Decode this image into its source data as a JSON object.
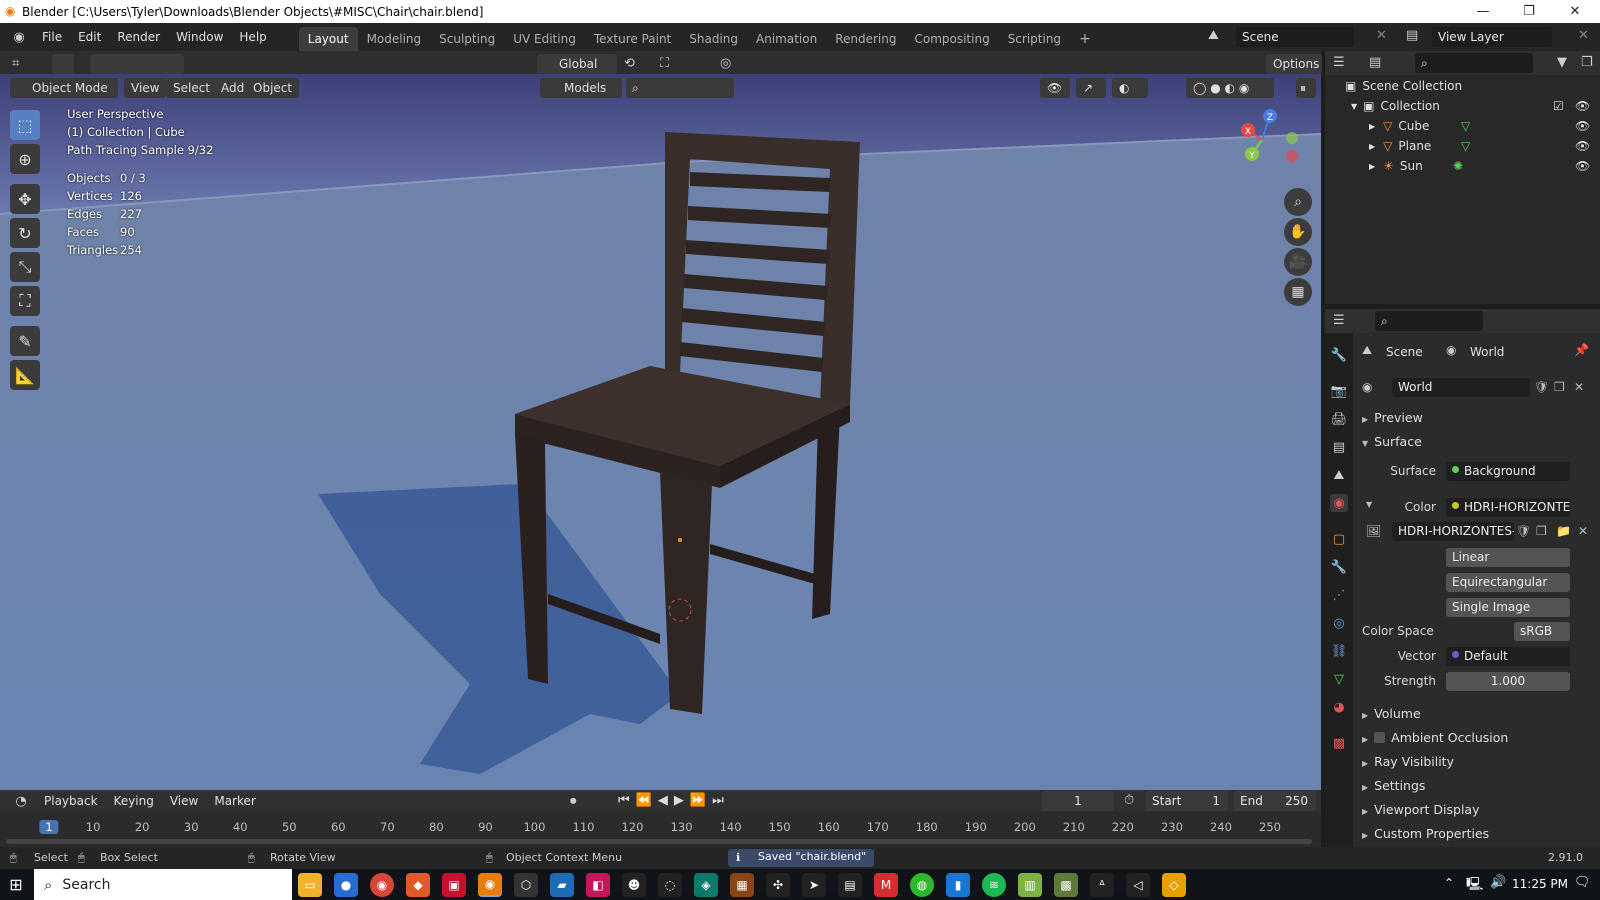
{
  "window": {
    "title": "Blender [C:\\Users\\Tyler\\Downloads\\Blender Objects\\#MISC\\Chair\\chair.blend]"
  },
  "menu": {
    "items": [
      "File",
      "Edit",
      "Render",
      "Window",
      "Help"
    ]
  },
  "workspaces": [
    "Layout",
    "Modeling",
    "Sculpting",
    "UV Editing",
    "Texture Paint",
    "Shading",
    "Animation",
    "Rendering",
    "Compositing",
    "Scripting"
  ],
  "active_workspace": "Layout",
  "scene_field": "Scene",
  "view_layer_field": "View Layer",
  "header": {
    "transform_orientation": "Global",
    "options_label": "Options"
  },
  "viewport_header": {
    "mode": "Object Mode",
    "view": "View",
    "select": "Select",
    "add": "Add",
    "object": "Object",
    "collection_filter": "Models"
  },
  "overlay": {
    "perspective": "User Perspective",
    "collection": "(1) Collection | Cube",
    "sample": "Path Tracing Sample 9/32"
  },
  "stats": [
    {
      "label": "Objects",
      "value": "0 / 3"
    },
    {
      "label": "Vertices",
      "value": "126"
    },
    {
      "label": "Edges",
      "value": "227"
    },
    {
      "label": "Faces",
      "value": "90"
    },
    {
      "label": "Triangles",
      "value": "254"
    }
  ],
  "gizmo": {
    "x": "X",
    "y": "Y",
    "z": "Z"
  },
  "outliner": {
    "root": "Scene Collection",
    "collection": "Collection",
    "items": [
      {
        "name": "Cube",
        "icon": "mesh-icon"
      },
      {
        "name": "Plane",
        "icon": "mesh-icon"
      },
      {
        "name": "Sun",
        "icon": "light-icon"
      }
    ]
  },
  "properties": {
    "breadcrumb_scene": "Scene",
    "breadcrumb_world": "World",
    "world_name": "World",
    "sections": {
      "preview": "Preview",
      "surface": "Surface",
      "volume": "Volume",
      "ambient_occlusion": "Ambient Occlusion",
      "ray_visibility": "Ray Visibility",
      "settings": "Settings",
      "viewport_display": "Viewport Display",
      "custom_properties": "Custom Properties"
    },
    "surface_label": "Surface",
    "surface_value": "Background",
    "color_label": "Color",
    "color_value": "HDRI-HORIZONTES-...",
    "image_name": "HDRI-HORIZONTES-...",
    "interpolation": "Linear",
    "projection": "Equirectangular",
    "source": "Single Image",
    "color_space_label": "Color Space",
    "color_space": "sRGB",
    "vector_label": "Vector",
    "vector_value": "Default",
    "strength_label": "Strength",
    "strength_value": "1.000"
  },
  "timeline": {
    "playback": "Playback",
    "keying": "Keying",
    "view": "View",
    "marker": "Marker",
    "current_frame": "1",
    "start_label": "Start",
    "start": "1",
    "end_label": "End",
    "end": "250",
    "ticks": [
      "1",
      "10",
      "20",
      "30",
      "40",
      "50",
      "60",
      "70",
      "80",
      "90",
      "100",
      "110",
      "120",
      "130",
      "140",
      "150",
      "160",
      "170",
      "180",
      "190",
      "200",
      "210",
      "220",
      "230",
      "240",
      "250"
    ]
  },
  "status": {
    "select": "Select",
    "box_select": "Box Select",
    "rotate_view": "Rotate View",
    "context_menu": "Object Context Menu",
    "saved": "Saved \"chair.blend\"",
    "version": "2.91.0"
  },
  "taskbar": {
    "search": "Search",
    "time": "11:25 PM"
  },
  "colors": {
    "accent": "#5680c2",
    "active_frame": "#4772b3",
    "header_bg": "#303030",
    "panel_bg": "#2b2b2b"
  }
}
